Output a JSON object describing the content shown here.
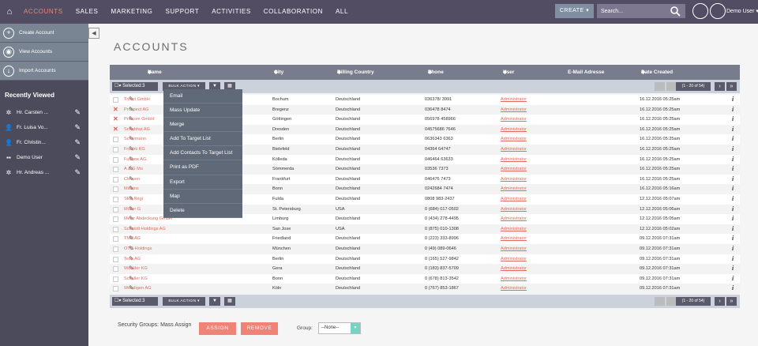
{
  "nav": {
    "items": [
      "ACCOUNTS",
      "SALES",
      "MARKETING",
      "SUPPORT",
      "ACTIVITIES",
      "COLLABORATION",
      "ALL"
    ],
    "active": "ACCOUNTS",
    "create_label": "CREATE",
    "search_placeholder": "Search...",
    "user_label": "Demo User"
  },
  "sidebar": {
    "actions": [
      "Create Account",
      "View Accounts",
      "Import Accounts"
    ],
    "recently_viewed_title": "Recently Viewed",
    "recent": [
      "Hr. Carsten ...",
      "Fr. Luisa Vo...",
      "Fr. Christin...",
      "Demo User",
      "Hr. Andreas ..."
    ]
  },
  "page": {
    "title": "ACCOUNTS"
  },
  "table": {
    "headers": [
      "Name",
      "City",
      "Billing Country",
      "Phone",
      "User",
      "E-Mail Adresse",
      "Date Created"
    ],
    "selected_label": "Selected:3",
    "bulk_label": "BULK ACTION",
    "pager_label": "(1 - 20 of 54)",
    "rows": [
      {
        "name": "Trinkit GmbH",
        "city": "Bochum",
        "country": "Deutschland",
        "phone": "036378/ 3991",
        "user": "Administrator",
        "date": "16.12.2016 05:25am",
        "sel": false
      },
      {
        "name": "Prospect AG",
        "city": "Bregenz",
        "country": "Deutschland",
        "phone": "036478 8474",
        "user": "Administrator",
        "date": "16.12.2016 05:25am",
        "sel": true
      },
      {
        "name": "Priocom GmbH",
        "city": "Göttingen",
        "country": "Deutschland",
        "phone": "056978 458966",
        "user": "Administrator",
        "date": "16.12.2016 05:25am",
        "sel": true
      },
      {
        "name": "Schubhut AG",
        "city": "Dresden",
        "country": "Deutschland",
        "phone": "04575686 7646",
        "user": "Administrator",
        "date": "16.12.2016 05:25am",
        "sel": true
      },
      {
        "name": "Schiemann",
        "city": "Berlin",
        "country": "Deutschland",
        "phone": "0636343 6363",
        "user": "Administrator",
        "date": "16.12.2016 05:25am",
        "sel": false
      },
      {
        "name": "Fruchti KG",
        "city": "Bielefeld",
        "country": "Deutschland",
        "phone": "04364 64747",
        "user": "Administrator",
        "date": "16.12.2016 05:25am",
        "sel": false
      },
      {
        "name": "Fußbox AG",
        "city": "Kölleda",
        "country": "Deutschland",
        "phone": "046464 63633",
        "user": "Administrator",
        "date": "16.12.2016 05:25am",
        "sel": false
      },
      {
        "name": "A & G Mo",
        "city": "Sömmerda",
        "country": "Deutschland",
        "phone": "03536 7373",
        "user": "Administrator",
        "date": "16.12.2016 05:25am",
        "sel": false
      },
      {
        "name": "Clevsen",
        "city": "Frankfurt",
        "country": "Deutschland",
        "phone": "046476 7473",
        "user": "Administrator",
        "date": "16.12.2016 05:25am",
        "sel": false
      },
      {
        "name": "Mickins",
        "city": "Bonn",
        "country": "Deutschland",
        "phone": "0242684 7474",
        "user": "Administrator",
        "date": "16.12.2016 05:16am",
        "sel": false
      },
      {
        "name": "SEA Regi",
        "city": "Fulda",
        "country": "Deutschland",
        "phone": "0808 983-2437",
        "user": "Administrator",
        "date": "12.12.2016 05:07am",
        "sel": false
      },
      {
        "name": "Müller G",
        "city": "St. Petersburg",
        "country": "USA",
        "phone": "0 (684) 017-0502",
        "user": "Administrator",
        "date": "12.12.2016 05:06am",
        "sel": false
      },
      {
        "name": "Meier Abdeckung GmbH",
        "city": "Limburg",
        "country": "Deutschland",
        "phone": "0 (434) 278-4495",
        "user": "Administrator",
        "date": "12.12.2016 05:05am",
        "sel": false
      },
      {
        "name": "Schmidt Holdings AG",
        "city": "San Jose",
        "country": "USA",
        "phone": "0 (875) 010-1308",
        "user": "Administrator",
        "date": "12.12.2016 05:02am",
        "sel": false
      },
      {
        "name": "TMP AG",
        "city": "Friedland",
        "country": "Deutschland",
        "phone": "0 (223) 333-8996",
        "user": "Administrator",
        "date": "09.12.2016 07:31am",
        "sel": false
      },
      {
        "name": "OTC-Holdings",
        "city": "München",
        "country": "Deutschland",
        "phone": "0 (49) 089-0646",
        "user": "Administrator",
        "date": "09.12.2016 07:31am",
        "sel": false
      },
      {
        "name": "Tech AG",
        "city": "Berlin",
        "country": "Deutschland",
        "phone": "0 (165) 527-9842",
        "user": "Administrator",
        "date": "09.12.2016 07:31am",
        "sel": false
      },
      {
        "name": "Wöckler KG",
        "city": "Gera",
        "country": "Deutschland",
        "phone": "0 (183) 837-5709",
        "user": "Administrator",
        "date": "09.12.2016 07:31am",
        "sel": false
      },
      {
        "name": "Schuller KG",
        "city": "Bonn",
        "country": "Deutschland",
        "phone": "0 (678) 813-3542",
        "user": "Administrator",
        "date": "09.12.2016 07:31am",
        "sel": false
      },
      {
        "name": "Wendigen AG",
        "city": "Köln",
        "country": "Deutschland",
        "phone": "0 (767) 853-1867",
        "user": "Administrator",
        "date": "09.12.2016 07:31am",
        "sel": false
      }
    ]
  },
  "bulk_menu": [
    "Email",
    "Mass Update",
    "Merge",
    "Add To Target List",
    "Add Contacts To Target List",
    "Print as PDF",
    "Export",
    "Map",
    "Delete"
  ],
  "footer": {
    "label": "Security Groups: Mass Assign",
    "assign": "ASSIGN",
    "remove": "REMOVE",
    "group_label": "Group:",
    "group_value": "--None--"
  },
  "colors": {
    "nav_bg": "#534d64",
    "accent": "#f08377",
    "sidebar_bg": "#4b4b5b",
    "header_bg": "#787c8c"
  }
}
